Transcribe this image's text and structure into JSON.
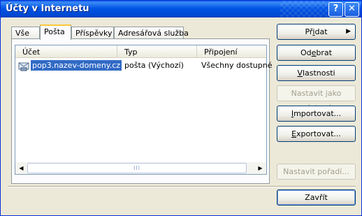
{
  "window": {
    "title": "Účty v Internetu"
  },
  "tabs": [
    {
      "label": "Vše"
    },
    {
      "label": "Pošta"
    },
    {
      "label": "Příspěvky"
    },
    {
      "label": "Adresářová služba"
    }
  ],
  "list": {
    "columns": [
      "Účet",
      "Typ",
      "Připojení"
    ],
    "rows": [
      {
        "account": "pop3.nazev-domeny.cz",
        "type": "pošta (Výchozí)",
        "connection": "Všechny dostupné"
      }
    ],
    "scroll_thumb": "III"
  },
  "buttons": {
    "add": {
      "pre": "Př",
      "u": "i",
      "post": "dat"
    },
    "remove": {
      "pre": "Od",
      "u": "e",
      "post": "brat"
    },
    "properties": {
      "pre": "",
      "u": "V",
      "post": "lastnosti"
    },
    "set_default": {
      "pre": "Nastavit jako výchozí",
      "u": "",
      "post": ""
    },
    "import": {
      "pre": "",
      "u": "I",
      "post": "mportovat..."
    },
    "export": {
      "pre": "",
      "u": "E",
      "post": "xportovat..."
    },
    "set_order": {
      "pre": "Nastavit pořadí...",
      "u": "",
      "post": ""
    },
    "close": {
      "label": "Zavřít"
    }
  }
}
